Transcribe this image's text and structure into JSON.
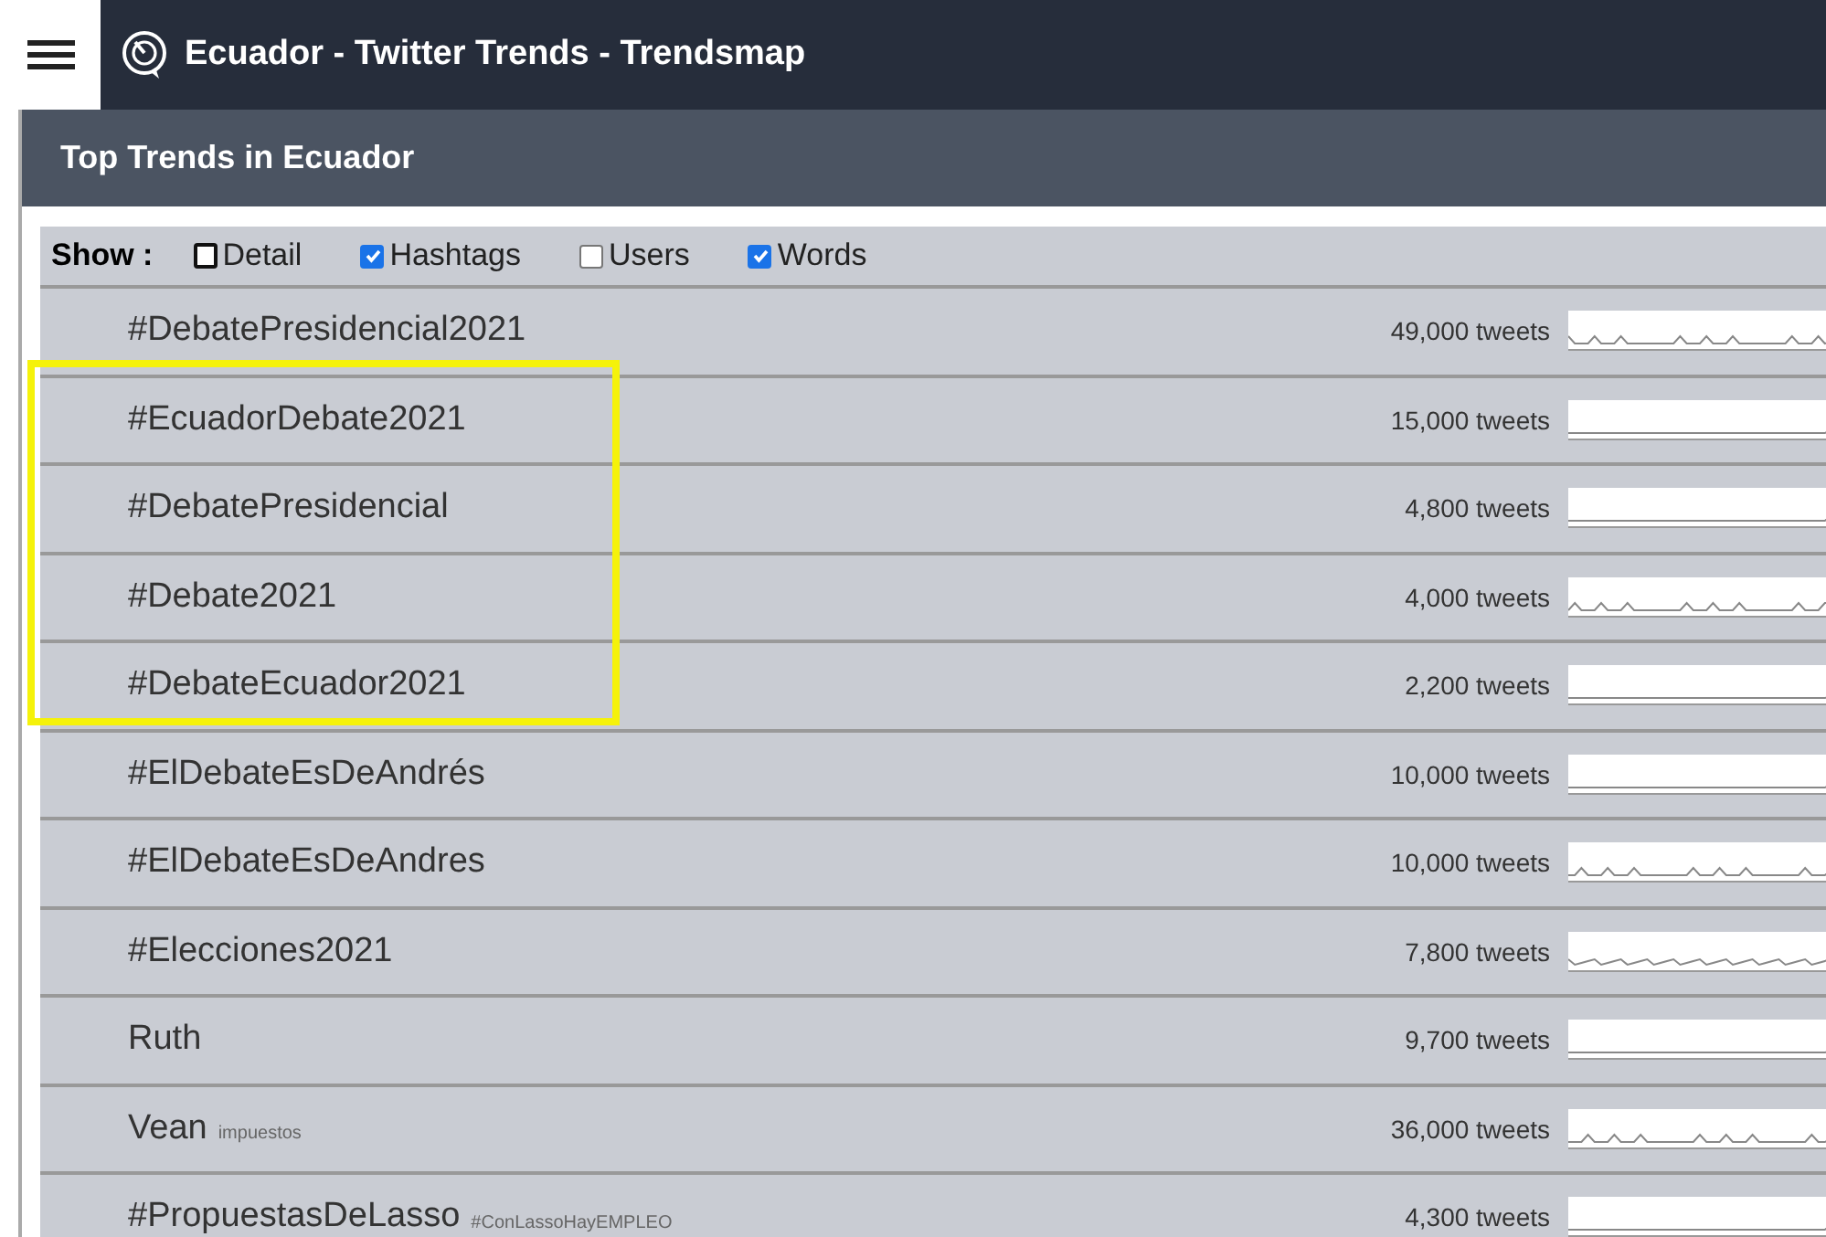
{
  "header": {
    "title": "Ecuador - Twitter Trends - Trendsmap"
  },
  "panel": {
    "title": "Top Trends in Ecuador"
  },
  "filters": {
    "label": "Show :",
    "options": [
      {
        "label": "Detail",
        "checked": false
      },
      {
        "label": "Hashtags",
        "checked": true
      },
      {
        "label": "Users",
        "checked": false
      },
      {
        "label": "Words",
        "checked": true
      }
    ]
  },
  "trends": [
    {
      "name": "#DebatePresidencial2021",
      "count": "49,000 tweets"
    },
    {
      "name": "#EcuadorDebate2021",
      "count": "15,000 tweets"
    },
    {
      "name": "#DebatePresidencial",
      "count": "4,800 tweets"
    },
    {
      "name": "#Debate2021",
      "count": "4,000 tweets"
    },
    {
      "name": "#DebateEcuador2021",
      "count": "2,200 tweets"
    },
    {
      "name": "#ElDebateEsDeAndrés",
      "count": "10,000 tweets"
    },
    {
      "name": "#ElDebateEsDeAndres",
      "count": "10,000 tweets"
    },
    {
      "name": "#Elecciones2021",
      "count": "7,800 tweets"
    },
    {
      "name": "Ruth",
      "count": "9,700 tweets"
    },
    {
      "name": "Vean",
      "related": "impuestos",
      "count": "36,000 tweets"
    },
    {
      "name": "#PropuestasDeLasso",
      "related": "#ConLassoHayEMPLEO",
      "count": "4,300 tweets"
    }
  ]
}
